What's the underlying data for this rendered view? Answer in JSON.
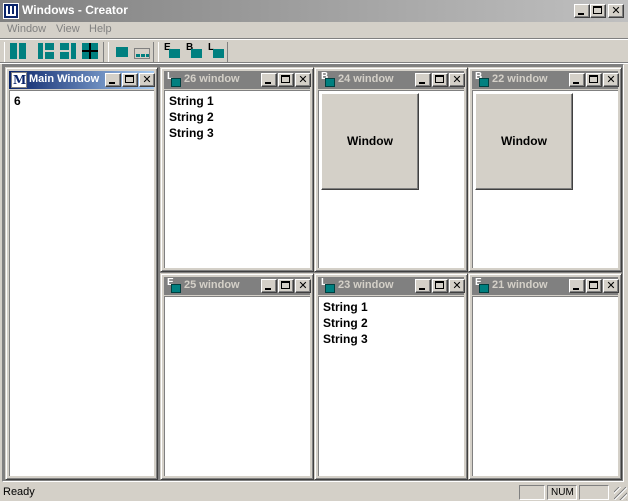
{
  "app": {
    "title": "Windows - Creator",
    "icon": "app-icon"
  },
  "menu": [
    "Window",
    "View",
    "Help"
  ],
  "toolbar": {
    "buttons": [
      "tile-vertical-icon",
      "tile-left-icon",
      "tile-right-icon",
      "tile-grid-icon",
      "minimize-all-icon",
      "arrange-icons-icon",
      "new-edit-window-icon",
      "new-button-window-icon",
      "new-list-window-icon"
    ],
    "letters": {
      "edit": "E",
      "button": "B",
      "list": "L"
    }
  },
  "windows": [
    {
      "id": "main",
      "title": "Main Window",
      "badge": "M",
      "active": true,
      "content_text": "6"
    },
    {
      "id": "w26",
      "title": "26 window",
      "badge": "L",
      "strings": [
        "String 1",
        "String 2",
        "String 3"
      ]
    },
    {
      "id": "w24",
      "title": "24 window",
      "badge": "B",
      "button_label": "Window"
    },
    {
      "id": "w22",
      "title": "22 window",
      "badge": "B",
      "button_label": "Window"
    },
    {
      "id": "w25",
      "title": "25 window",
      "badge": "E"
    },
    {
      "id": "w23",
      "title": "23 window",
      "badge": "L",
      "strings": [
        "String 1",
        "String 2",
        "String 3"
      ]
    },
    {
      "id": "w21",
      "title": "21 window",
      "badge": "E"
    }
  ],
  "status": {
    "text": "Ready",
    "panel1": "",
    "panel2": "NUM",
    "panel3": ""
  },
  "colors": {
    "active_caption": "#0a246a",
    "inactive_caption": "#808080",
    "face": "#d4d0c8",
    "accent": "#008080"
  }
}
